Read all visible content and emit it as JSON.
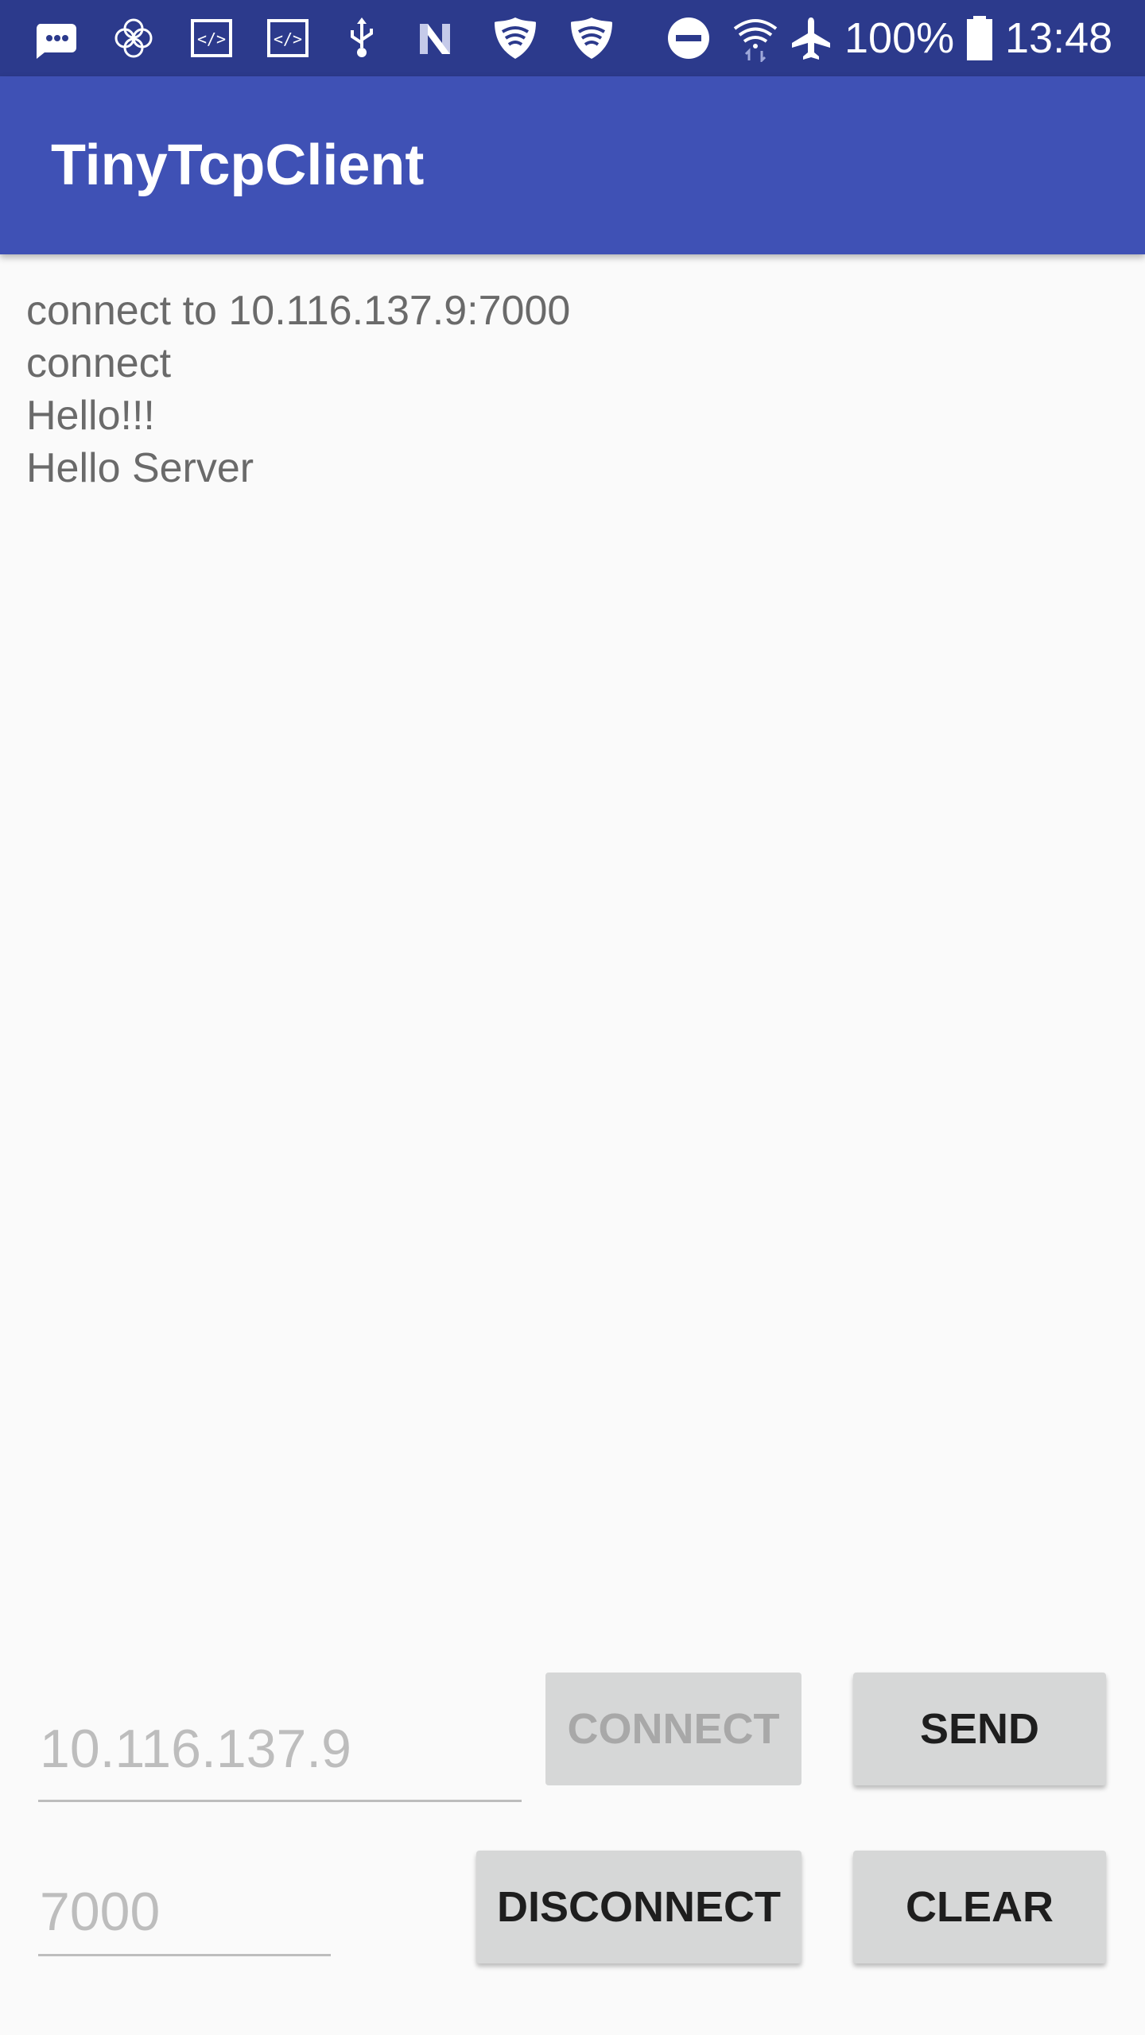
{
  "status_bar": {
    "battery": "100%",
    "time": "13:48",
    "icons": [
      "messages-icon",
      "flower-icon",
      "code-icon",
      "code-icon",
      "usb-icon",
      "n-icon",
      "shield-icon",
      "shield-icon",
      "dnd-icon",
      "wifi-icon",
      "airplane-icon",
      "battery-icon"
    ]
  },
  "app_bar": {
    "title": "TinyTcpClient"
  },
  "log": [
    "connect to 10.116.137.9:7000",
    "connect",
    "Hello!!!",
    "Hello Server"
  ],
  "inputs": {
    "ip_value": "10.116.137.9",
    "port_value": "7000"
  },
  "buttons": {
    "connect": "CONNECT",
    "send": "SEND",
    "disconnect": "DISCONNECT",
    "clear": "CLEAR"
  },
  "colors": {
    "primary": "#3f51b5",
    "primary_dark": "#2c3a8c",
    "button_bg": "#d6d7d7"
  }
}
